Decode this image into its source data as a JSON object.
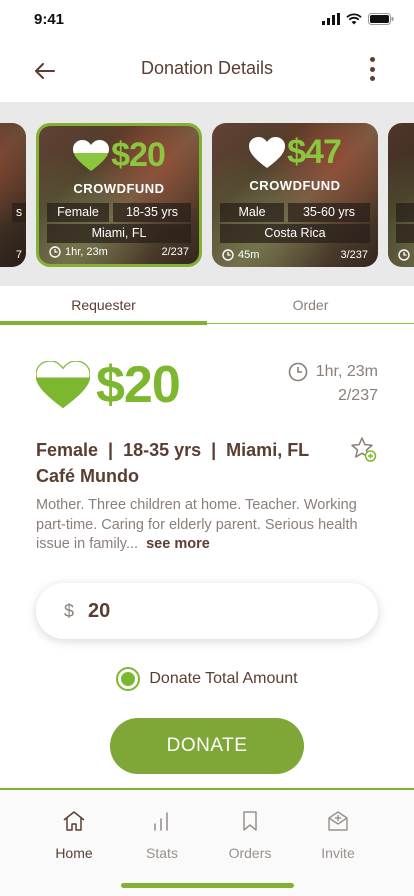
{
  "status": {
    "time": "9:41"
  },
  "header": {
    "title": "Donation Details"
  },
  "cards": [
    {
      "amount": "$20",
      "type": "CROWDFUND",
      "gender": "Female",
      "age": "18-35 yrs",
      "location": "Miami, FL",
      "time": "1hr, 23m",
      "count": "2/237"
    },
    {
      "amount": "$47",
      "type": "CROWDFUND",
      "gender": "Male",
      "age": "35-60 yrs",
      "location": "Costa Rica",
      "time": "45m",
      "count": "3/237"
    }
  ],
  "card_left_partial": {
    "chip": "s",
    "count": "7"
  },
  "tabs": {
    "requester": "Requester",
    "order": "Order"
  },
  "detail": {
    "amount": "$20",
    "time": "1hr, 23m",
    "count": "2/237",
    "demographics": "Female  |  18-35 yrs  |  Miami, FL",
    "organization": "Café Mundo",
    "description": "Mother. Three children at home. Teacher. Working part-time. Caring for elderly parent. Serious health issue in family...",
    "see_more": "see more"
  },
  "donation": {
    "currency": "$",
    "value": "20",
    "option_label": "Donate Total Amount",
    "button_label": "DONATE"
  },
  "nav": {
    "home": "Home",
    "stats": "Stats",
    "orders": "Orders",
    "invite": "Invite"
  },
  "colors": {
    "accent": "#7db72f",
    "button": "#7ea737",
    "text_primary": "#5a3e32",
    "text_secondary": "#8a7f79"
  }
}
